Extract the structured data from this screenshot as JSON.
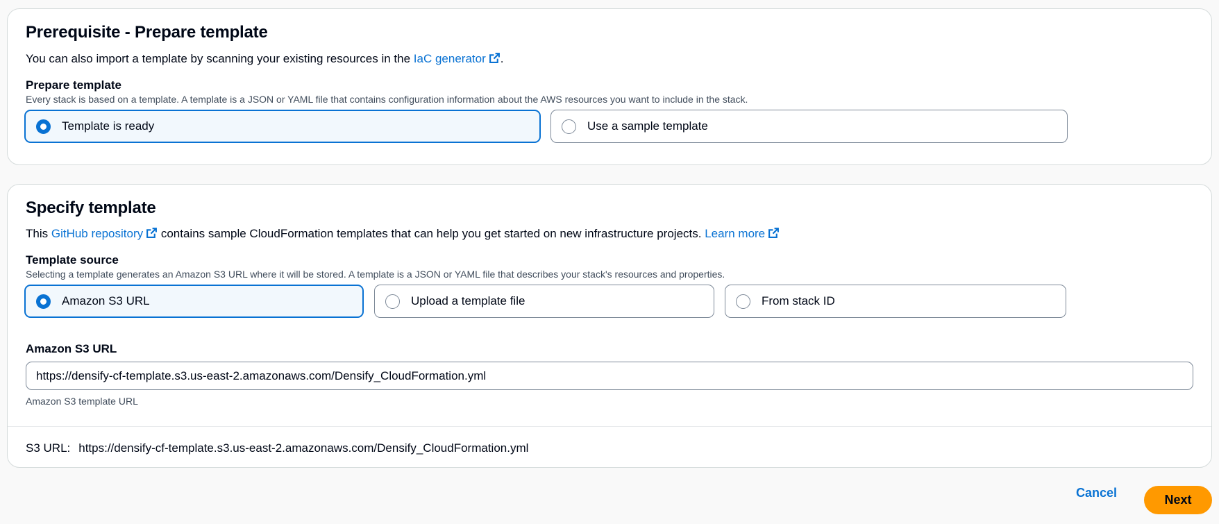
{
  "prerequisite": {
    "title": "Prerequisite - Prepare template",
    "description_prefix": "You can also import a template by scanning your existing resources in the ",
    "description_link": "IaC generator",
    "description_suffix": ".",
    "prepare_label": "Prepare template",
    "prepare_hint": "Every stack is based on a template. A template is a JSON or YAML file that contains configuration information about the AWS resources you want to include in the stack.",
    "options": [
      {
        "label": "Template is ready",
        "selected": true
      },
      {
        "label": "Use a sample template",
        "selected": false
      }
    ]
  },
  "specify": {
    "title": "Specify template",
    "description_prefix": "This ",
    "description_link": "GitHub repository",
    "description_middle": " contains sample CloudFormation templates that can help you get started on new infrastructure projects. ",
    "learn_more": "Learn more",
    "source_label": "Template source",
    "source_hint": "Selecting a template generates an Amazon S3 URL where it will be stored. A template is a JSON or YAML file that describes your stack's resources and properties.",
    "options": [
      {
        "label": "Amazon S3 URL",
        "selected": true
      },
      {
        "label": "Upload a template file",
        "selected": false
      },
      {
        "label": "From stack ID",
        "selected": false
      }
    ],
    "s3_label": "Amazon S3 URL",
    "s3_value": "https://densify-cf-template.s3.us-east-2.amazonaws.com/Densify_CloudFormation.yml",
    "s3_hint": "Amazon S3 template URL",
    "footer_label": "S3 URL:",
    "footer_value": "https://densify-cf-template.s3.us-east-2.amazonaws.com/Densify_CloudFormation.yml"
  },
  "actions": {
    "cancel_label": "Cancel",
    "next_label": "Next"
  },
  "icons": {
    "external_link": "external-link-icon"
  },
  "colors": {
    "accent": "#0972d3",
    "primary_button": "#ff9900",
    "selected_tile_bg": "#f2f8fd"
  }
}
